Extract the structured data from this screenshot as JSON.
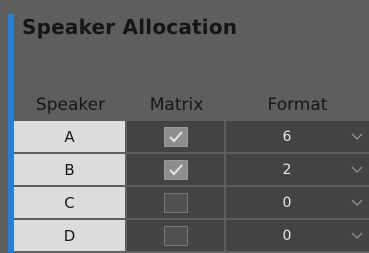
{
  "panel": {
    "title": "Speaker Allocation",
    "accent_color": "#2a7fcf"
  },
  "columns": {
    "speaker": "Speaker",
    "matrix": "Matrix",
    "format": "Format"
  },
  "rows": [
    {
      "speaker": "A",
      "matrix_checked": true,
      "format": "6"
    },
    {
      "speaker": "B",
      "matrix_checked": true,
      "format": "2"
    },
    {
      "speaker": "C",
      "matrix_checked": false,
      "format": "0"
    },
    {
      "speaker": "D",
      "matrix_checked": false,
      "format": "0"
    }
  ]
}
